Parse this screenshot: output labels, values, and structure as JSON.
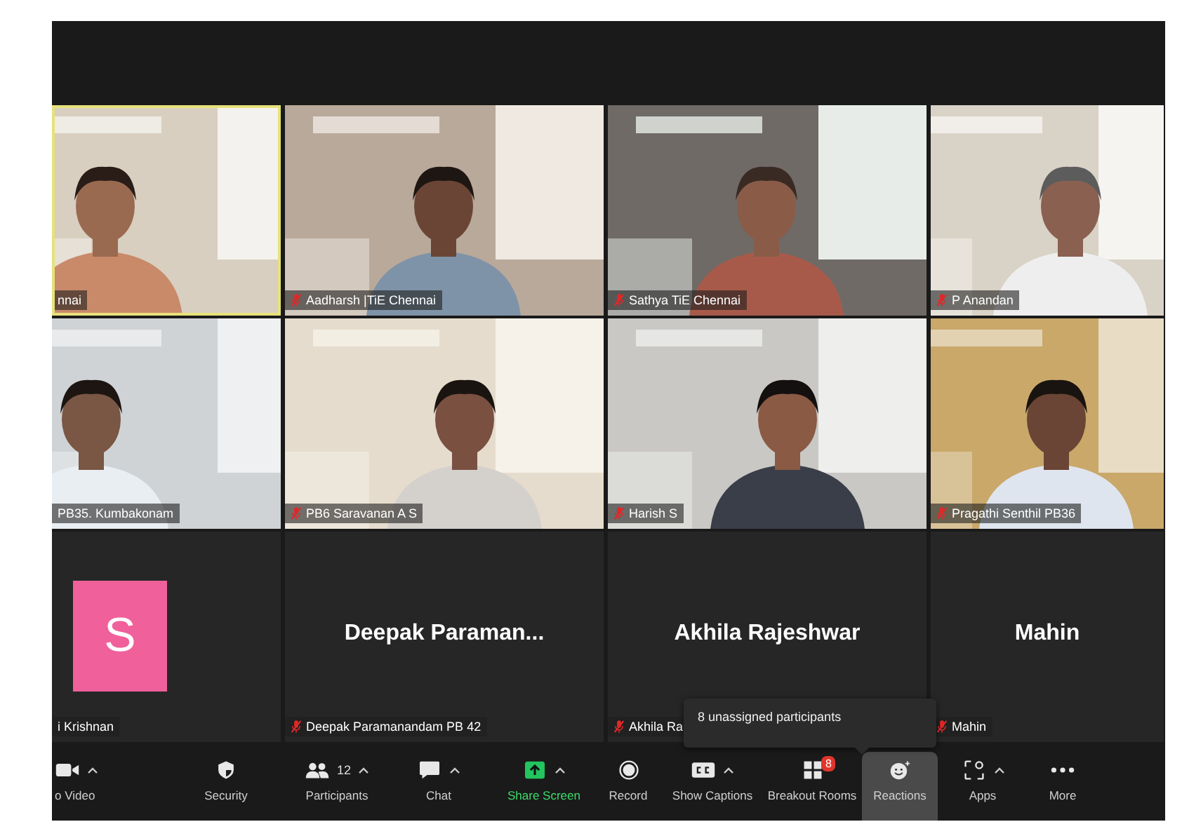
{
  "tiles": [
    {
      "kind": "video",
      "name": "nnai",
      "muted": false,
      "speaking": true
    },
    {
      "kind": "video",
      "name": "Aadharsh |TiE Chennai",
      "muted": true,
      "speaking": false
    },
    {
      "kind": "video",
      "name": "Sathya TiE Chennai",
      "muted": true,
      "speaking": false
    },
    {
      "kind": "video",
      "name": "P Anandan",
      "muted": true,
      "speaking": false
    },
    {
      "kind": "video",
      "name": "PB35. Kumbakonam",
      "muted": false,
      "speaking": false
    },
    {
      "kind": "video",
      "name": "PB6 Saravanan A S",
      "muted": true,
      "speaking": false
    },
    {
      "kind": "video",
      "name": "Harish S",
      "muted": true,
      "speaking": false
    },
    {
      "kind": "video",
      "name": "Pragathi Senthil PB36",
      "muted": true,
      "speaking": false
    },
    {
      "kind": "avatar",
      "initial": "S",
      "color": "#f0609a",
      "name": "i Krishnan",
      "muted": false,
      "speaking": false
    },
    {
      "kind": "named",
      "display": "Deepak Paraman...",
      "name": "Deepak Paramanandam PB 42",
      "muted": true,
      "speaking": false
    },
    {
      "kind": "named",
      "display": "Akhila Rajeshwar",
      "name": "Akhila Ra",
      "muted": true,
      "speaking": false
    },
    {
      "kind": "named",
      "display": "Mahin",
      "name": "Mahin",
      "muted": true,
      "speaking": false
    }
  ],
  "tooltip": {
    "text": "8 unassigned participants"
  },
  "toolbar": [
    {
      "kind": "video",
      "label": "o Video",
      "caret": true,
      "selected": false
    },
    {
      "kind": "security",
      "label": "Security",
      "caret": false,
      "selected": false
    },
    {
      "kind": "participants",
      "label": "Participants",
      "count": "12",
      "caret": true,
      "selected": false
    },
    {
      "kind": "chat",
      "label": "Chat",
      "caret": true,
      "selected": false
    },
    {
      "kind": "share",
      "label": "Share Screen",
      "caret": true,
      "selected": false
    },
    {
      "kind": "record",
      "label": "Record",
      "caret": false,
      "selected": false
    },
    {
      "kind": "captions",
      "label": "Show Captions",
      "caret": true,
      "selected": false
    },
    {
      "kind": "breakout",
      "label": "Breakout Rooms",
      "badge": "8",
      "caret": false,
      "selected": false
    },
    {
      "kind": "reactions",
      "label": "Reactions",
      "caret": false,
      "selected": true
    },
    {
      "kind": "apps",
      "label": "Apps",
      "caret": true,
      "selected": false
    },
    {
      "kind": "more",
      "label": "More",
      "caret": false,
      "selected": false
    }
  ]
}
